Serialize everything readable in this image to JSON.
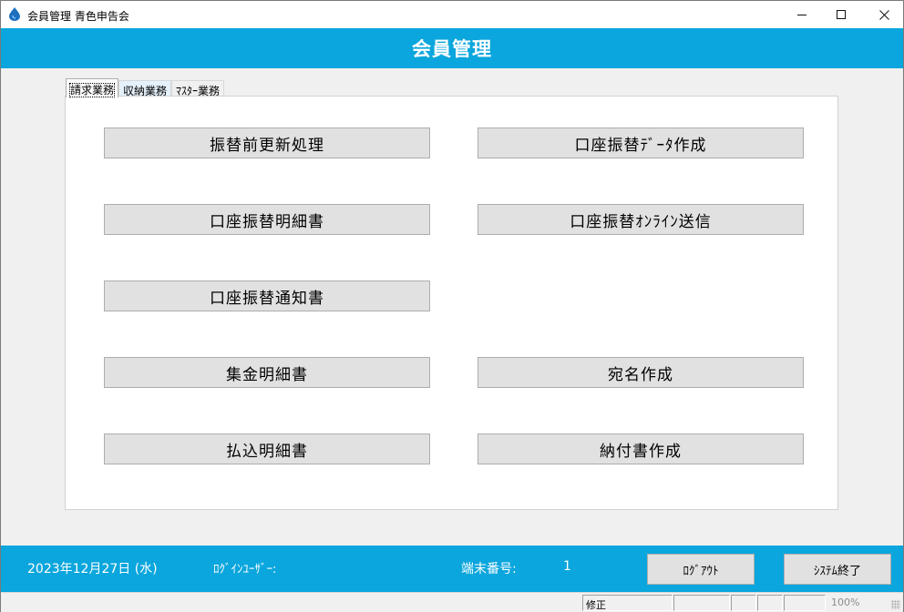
{
  "window": {
    "title": "会員管理 青色申告会",
    "minimize_icon": "minimize-icon",
    "maximize_icon": "maximize-icon",
    "close_icon": "close-icon"
  },
  "header": {
    "title": "会員管理"
  },
  "tabs": [
    {
      "label": "請求業務",
      "active": true
    },
    {
      "label": "収納業務",
      "active": false
    },
    {
      "label": "ﾏｽﾀｰ業務",
      "active": false
    }
  ],
  "buttons": {
    "b1": "振替前更新処理",
    "b2": "口座振替ﾃﾞｰﾀ作成",
    "b3": "口座振替明細書",
    "b4": "口座振替ｵﾝﾗｲﾝ送信",
    "b5": "口座振替通知書",
    "b6": "集金明細書",
    "b7": "宛名作成",
    "b8": "払込明細書",
    "b9": "納付書作成"
  },
  "footer": {
    "date": "2023年12月27日 (水)",
    "login_user_label": "ﾛｸﾞｲﾝﾕｰｻﾞｰ:",
    "terminal_label": "端末番号:",
    "terminal_value": "1",
    "logout_label": "ﾛｸﾞｱｳﾄ",
    "exit_label": "ｼｽﾃﾑ終了"
  },
  "statusbar": {
    "mode": "修正",
    "zoom": "100%"
  },
  "colors": {
    "accent": "#0aa6dd",
    "button_face": "#e1e1e1"
  }
}
